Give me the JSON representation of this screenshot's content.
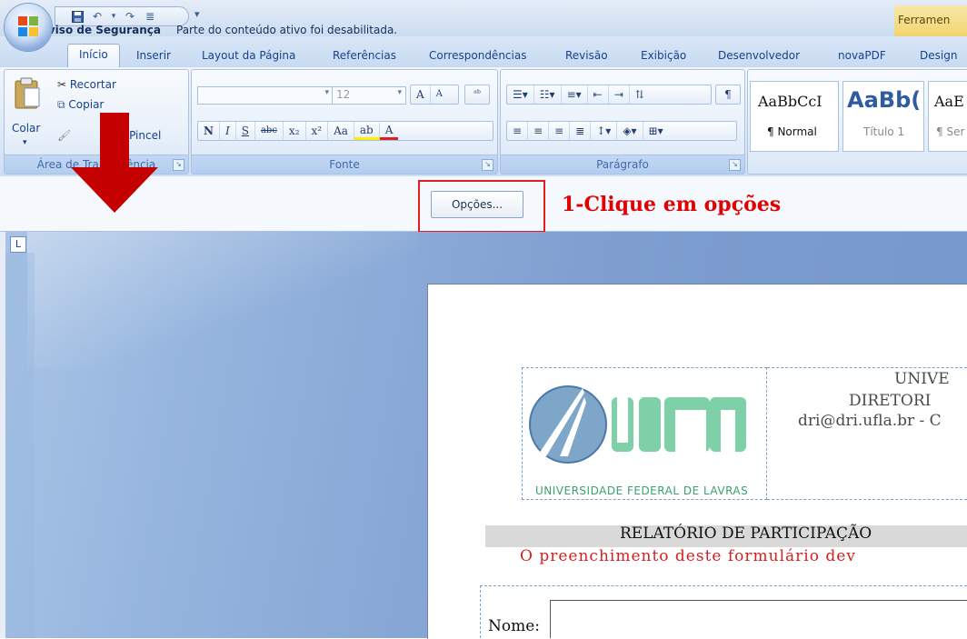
{
  "qat": {
    "save_icon": "save-icon",
    "undo_icon": "undo-icon",
    "redo_icon": "redo-icon",
    "format_icon": "format-icon",
    "more_icon": "customize-icon"
  },
  "contextual_tab_title": "Ferramen",
  "tabs": [
    {
      "label": "Início",
      "active": true
    },
    {
      "label": "Inserir"
    },
    {
      "label": "Layout da Página"
    },
    {
      "label": "Referências"
    },
    {
      "label": "Correspondências"
    },
    {
      "label": "Revisão"
    },
    {
      "label": "Exibição"
    },
    {
      "label": "Desenvolvedor"
    },
    {
      "label": "novaPDF"
    },
    {
      "label": "Design"
    }
  ],
  "ribbon": {
    "clipboard": {
      "group_label": "Área de Transferência",
      "paste_label": "Colar",
      "cut_label": "Recortar",
      "copy_label": "Copiar",
      "format_painter_label": "Pincel"
    },
    "font": {
      "group_label": "Fonte",
      "font_size": "12",
      "grow_label": "A",
      "shrink_label": "A",
      "buttons": [
        "N",
        "I",
        "S",
        "abc",
        "x₂",
        "x²",
        "Aa",
        "ab",
        "A"
      ]
    },
    "paragraph": {
      "group_label": "Parágrafo",
      "pilcrow": "¶"
    },
    "styles": [
      {
        "preview": "AaBbCcI",
        "label": "¶ Normal"
      },
      {
        "preview": "AaBb(",
        "label": "Título 1"
      },
      {
        "preview": "AaE",
        "label": "¶ Ser"
      }
    ]
  },
  "security_bar": {
    "title": "Aviso de Segurança",
    "message": "Parte do conteúdo ativo foi desabilitada.",
    "options_button": "Opções..."
  },
  "annotation": {
    "text": "1-Clique em opções",
    "color": "#e00000"
  },
  "ruler_button": "L",
  "document": {
    "logo_text": "UNIVERSIDADE FEDERAL DE LAVRAS",
    "logo_letters": "UFLA",
    "header_line1": "UNIVE",
    "header_line2": "DIRETORI",
    "header_line3": "dri@dri.ufla.br - C",
    "report_title": "RELATÓRIO DE PARTICIPAÇÃO",
    "report_subtitle": "O preenchimento deste formulário dev",
    "name_label": "Nome:"
  }
}
